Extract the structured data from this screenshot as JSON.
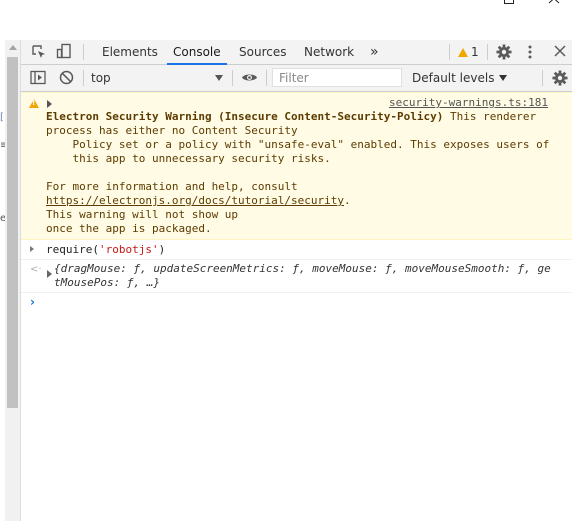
{
  "window": {
    "controls": [
      "minimize-icon",
      "maximize-icon",
      "close-icon"
    ]
  },
  "toolbar": {
    "tabs": [
      {
        "label": "Elements",
        "active": false
      },
      {
        "label": "Console",
        "active": true
      },
      {
        "label": "Sources",
        "active": false
      },
      {
        "label": "Network",
        "active": false
      }
    ],
    "more_tabs": "»",
    "warning_count": "1",
    "icons": [
      "inspect-element-icon",
      "device-toolbar-icon",
      "settings-icon",
      "kebab-menu-icon",
      "close-icon"
    ]
  },
  "console_toolbar": {
    "context": "top",
    "filter_placeholder": "Filter",
    "levels": "Default levels",
    "icons": [
      "sidebar-toggle-icon",
      "clear-console-icon",
      "eye-icon",
      "settings-icon"
    ]
  },
  "colors": {
    "accent": "#1a73e8",
    "warning_bg": "#fffbe5",
    "warning_text": "#5c3c00",
    "warning_icon": "#f2a600",
    "string": "#c41a16"
  },
  "console": {
    "warning": {
      "source": "security-warnings.ts:181",
      "title": "Electron Security Warning (Insecure Content-Security-Policy)",
      "title_suffix": " This renderer",
      "line2": "process has either no Content Security",
      "line3": "    Policy set or a policy with \"unsafe-eval\" enabled. This exposes users of",
      "line4": "    this app to unnecessary security risks.",
      "line5": "For more information and help, consult",
      "link": "https://electronjs.org/docs/tutorial/security",
      "link_suffix": ".",
      "line7": "This warning will not show up",
      "line8": "once the app is packaged."
    },
    "input": {
      "prefix": "require(",
      "string": "'robotjs'",
      "suffix": ")"
    },
    "result": {
      "line1": "{dragMouse: ƒ, updateScreenMetrics: ƒ, moveMouse: ƒ, moveMouseSmooth: ƒ, ge",
      "line2": "tMousePos: ƒ, …}"
    },
    "prompt": "›"
  }
}
